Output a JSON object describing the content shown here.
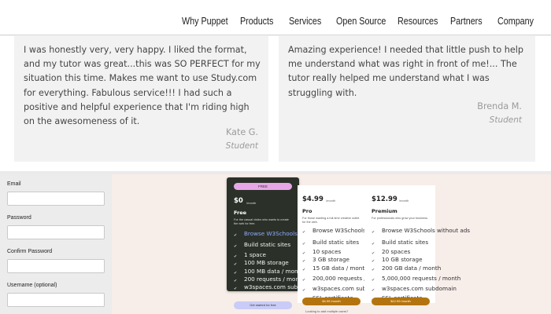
{
  "nav": {
    "items": [
      "Why Puppet",
      "Products",
      "Services",
      "Open Source",
      "Resources",
      "Partners",
      "Company"
    ]
  },
  "testimonials": [
    {
      "quote_lines": [
        "I was honestly very, very happy. I liked the format,",
        "and my tutor was great...this was SO PERFECT for my",
        "situation this time. Makes me want to use Study.com",
        "for everything. Fabulous service!!! I had such a",
        "positive and helpful experience that I'm riding high",
        "on the awesomeness of it."
      ],
      "author": "Kate G.",
      "role": "Student"
    },
    {
      "quote_lines": [
        "Amazing experience! I needed that little push to help",
        "me understand what was right in front of me!... The",
        "tutor really helped me understand what I was",
        "struggling with."
      ],
      "author": "Brenda M.",
      "role": "Student"
    }
  ],
  "form": {
    "fields": [
      {
        "label": "Email",
        "value": ""
      },
      {
        "label": "Password",
        "value": ""
      },
      {
        "label": "Confirm Password",
        "value": ""
      },
      {
        "label": "Username (optional)",
        "value": ""
      }
    ]
  },
  "pricing": {
    "plans": [
      {
        "badge": "FREE",
        "price": "$0",
        "per": "/month",
        "name": "Free",
        "desc": "For the casual visitor who wants to create the web for free.",
        "features": [
          "Browse W3Schools without ads",
          "Build static sites",
          "1 space",
          "100 MB storage",
          "100 MB data / month",
          "200 requests / month",
          "w3spaces.com subdomain"
        ],
        "cta": "Get started for free"
      },
      {
        "price": "$4.99",
        "per": "/month",
        "name": "Pro",
        "desc": "For those wanting a full-time creative outlet for the web.",
        "features": [
          "Browse W3Schools without ads",
          "Build static sites",
          "10 spaces",
          "3 GB storage",
          "15 GB data / month",
          "200,000 requests / month",
          "w3spaces.com subdomain",
          "SSL certificate"
        ],
        "cta": "$4.99 /month"
      },
      {
        "price": "$12.99",
        "per": "/month",
        "name": "Premium",
        "desc": "For professionals who grow your business.",
        "features": [
          "Browse W3Schools without ads",
          "Build static sites",
          "20 spaces",
          "10 GB storage",
          "200 GB data / month",
          "5,000,000 requests / month",
          "w3spaces.com subdomain",
          "SSL certificate"
        ],
        "cta": "$12.99 /month"
      }
    ],
    "footnote": "Looking to add multiple users?"
  },
  "colors": {
    "free_card": "#2b3129",
    "free_badge": "#e7a7e6",
    "free_cta": "#c9ccf6",
    "paid_cta": "#b3740f",
    "pricing_bg": "#f7ede9"
  }
}
